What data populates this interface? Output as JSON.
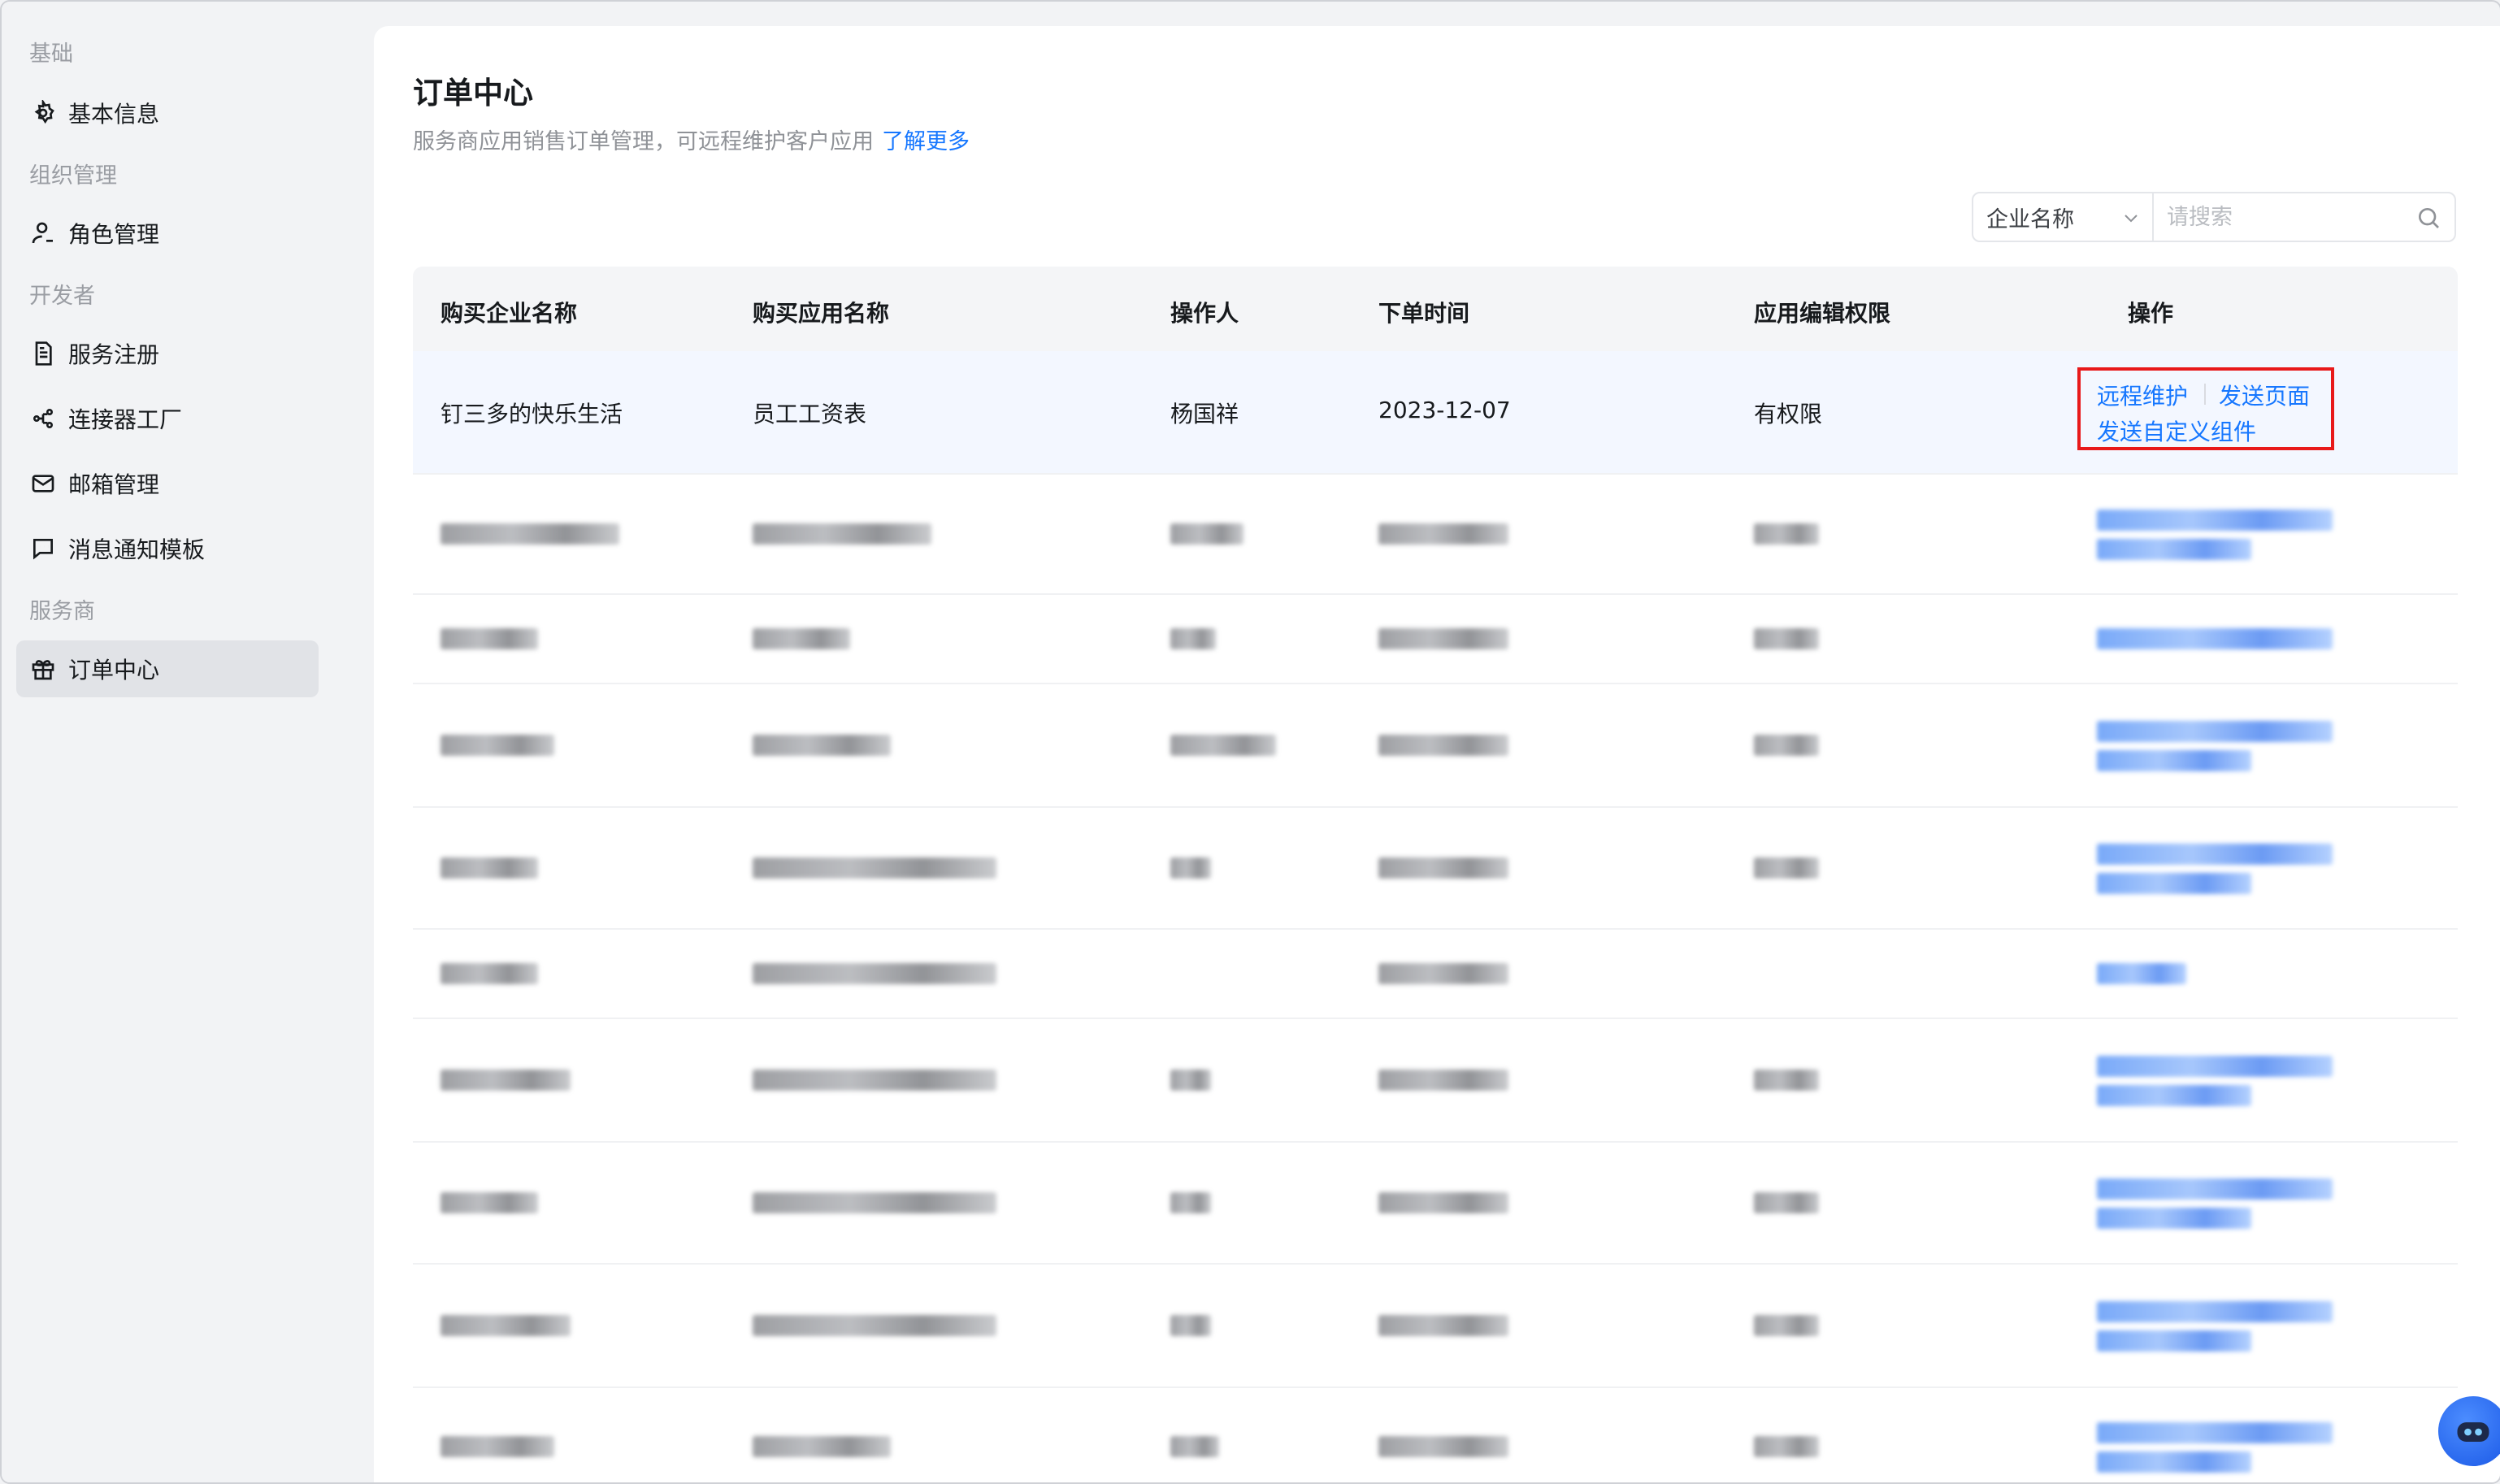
{
  "sidebar": {
    "groups": [
      {
        "label": "基础",
        "items": [
          {
            "label": "基本信息",
            "icon": "gear-icon"
          }
        ]
      },
      {
        "label": "组织管理",
        "items": [
          {
            "label": "角色管理",
            "icon": "user-role-icon"
          }
        ]
      },
      {
        "label": "开发者",
        "items": [
          {
            "label": "服务注册",
            "icon": "document-icon"
          },
          {
            "label": "连接器工厂",
            "icon": "connector-icon"
          },
          {
            "label": "邮箱管理",
            "icon": "mail-icon"
          },
          {
            "label": "消息通知模板",
            "icon": "message-icon"
          }
        ]
      },
      {
        "label": "服务商",
        "items": [
          {
            "label": "订单中心",
            "icon": "gift-icon",
            "active": true
          }
        ]
      }
    ]
  },
  "main": {
    "title": "订单中心",
    "description": "服务商应用销售订单管理，可远程维护客户应用",
    "learn_more": "了解更多",
    "filter": {
      "select_value": "企业名称",
      "search_placeholder": "请搜索"
    },
    "table": {
      "columns": [
        "购买企业名称",
        "购买应用名称",
        "操作人",
        "下单时间",
        "应用编辑权限",
        "操作"
      ],
      "first_row": {
        "company": "钉三多的快乐生活",
        "app": "员工工资表",
        "operator": "杨国祥",
        "date": "2023-12-07",
        "permission": "有权限",
        "actions": [
          "远程维护",
          "发送页面",
          "发送自定义组件"
        ]
      }
    }
  },
  "colors": {
    "accent": "#1677ff",
    "highlight_box": "#e8191a",
    "active_nav": "#e1e3e7"
  }
}
